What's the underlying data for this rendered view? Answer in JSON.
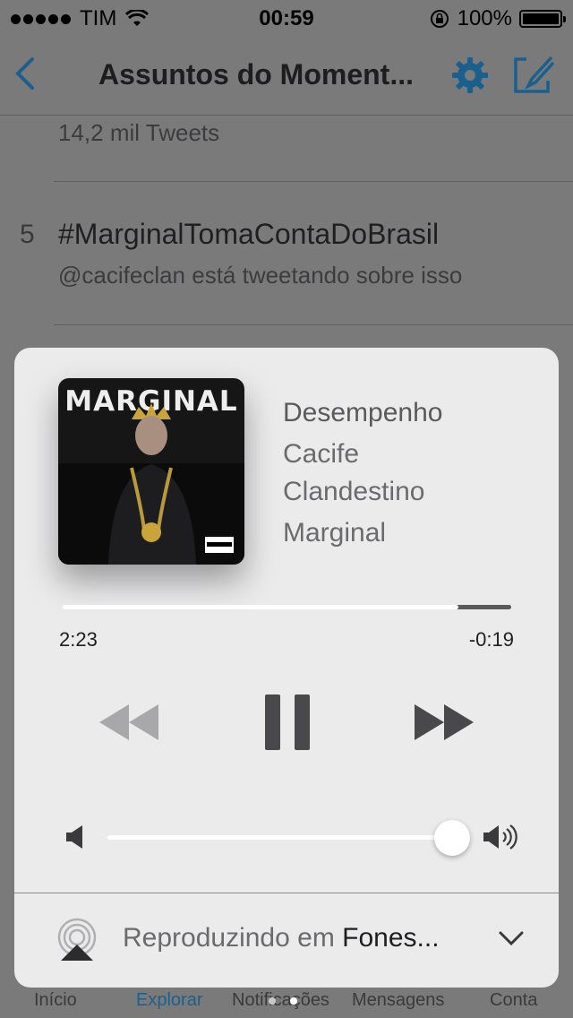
{
  "status_bar": {
    "carrier": "TIM",
    "time": "00:59",
    "battery": "100%"
  },
  "nav": {
    "title": "Assuntos do Moment...",
    "icons": [
      "back-chevron",
      "gear",
      "compose"
    ]
  },
  "trends": {
    "previous_tweet_count": "14,2 mil Tweets",
    "items": [
      {
        "rank": "5",
        "hashtag": "#MarginalTomaContaDoBrasil",
        "subtitle": "@cacifeclan está tweetando sobre isso"
      }
    ]
  },
  "now_playing": {
    "album_art_title": "MARGINAL",
    "song": "Desempenho",
    "artist": "Cacife Clandestino",
    "album": "Marginal",
    "elapsed": "2:23",
    "remaining": "-0:19",
    "progress": 0.883,
    "volume": 0.96,
    "airplay_prefix": "Reproduzindo em",
    "airplay_device": "Fones...",
    "accent_color": "#1b5f8f"
  },
  "tabs": [
    {
      "label": "Início",
      "active": false
    },
    {
      "label": "Explorar",
      "active": true
    },
    {
      "label": "Notificações",
      "active": false
    },
    {
      "label": "Mensagens",
      "active": false
    },
    {
      "label": "Conta",
      "active": false
    }
  ]
}
